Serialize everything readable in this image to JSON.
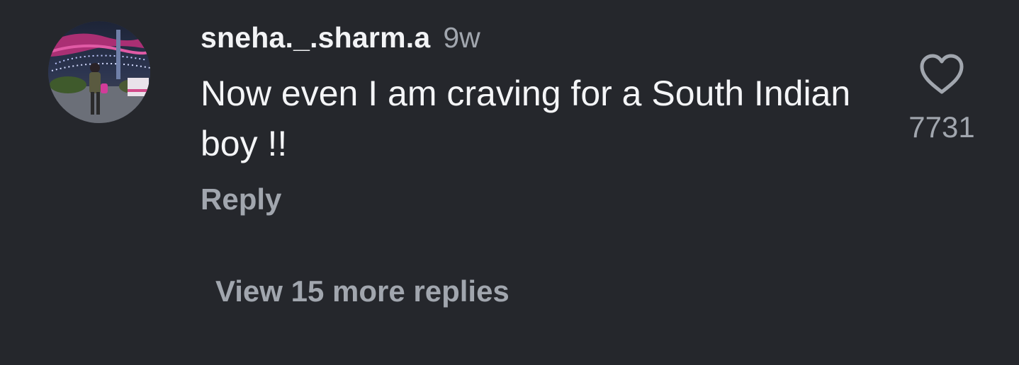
{
  "comment": {
    "username": "sneha._.sharm.a",
    "time": "9w",
    "text": "Now even I am craving for a South Indian boy !!",
    "reply_label": "Reply",
    "like_count": "7731",
    "view_replies_label": "View 15 more replies",
    "like_icon": "heart-outline-icon"
  },
  "colors": {
    "background": "#25272c",
    "text_primary": "#f4f5f7",
    "text_secondary": "#a1a6ae"
  }
}
